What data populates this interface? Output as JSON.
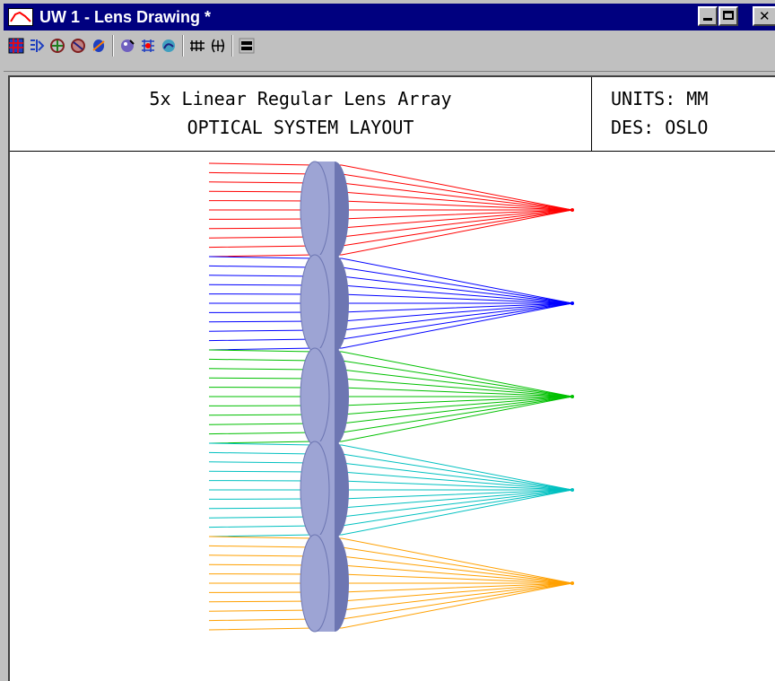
{
  "window": {
    "title": "UW 1 - Lens Drawing *"
  },
  "titlebar_icons": {
    "app": "graph-line-icon",
    "minimize": "minimize-icon",
    "maximize": "maximize-icon",
    "close": "close-icon"
  },
  "titlebar_glyphs": {
    "close": "✕"
  },
  "toolbar": {
    "buttons": [
      {
        "name": "grid-icon",
        "color": "#1f3fbf"
      },
      {
        "name": "lens-layout-icon",
        "color": "#1f3fbf"
      },
      {
        "name": "3d-ray-icon",
        "color": "#7f1f1f"
      },
      {
        "name": "solid-3d-icon",
        "color": "#7f1f1f"
      },
      {
        "name": "shaded-lens-icon",
        "color": "#1f3fbf"
      },
      {
        "name": "spot-diagram-icon",
        "color": "#3f1f7f"
      },
      {
        "name": "wavefront-icon",
        "color": "#1f3fbf"
      },
      {
        "name": "mtf-icon",
        "color": "#1f3fbf"
      },
      {
        "name": "field-curve-icon",
        "color": "#000000"
      },
      {
        "name": "aberration-icon",
        "color": "#000000"
      },
      {
        "name": "opc-icon",
        "color": "#000000"
      }
    ]
  },
  "drawing": {
    "title": "5x Linear Regular Lens Array",
    "subtitle": "OPTICAL SYSTEM LAYOUT",
    "units": "UNITS: MM",
    "designer": "DES: OSLO"
  },
  "colors": {
    "titlebar": "#00007f",
    "lens_fill": "#9da4d4",
    "lens_edge": "#6d76b2",
    "ray_red": "#ff0000",
    "ray_blue": "#0000ff",
    "ray_green": "#00c000",
    "ray_cyan": "#00c0c0",
    "ray_orange": "#ffa000"
  },
  "lens_array": {
    "count": 5,
    "rays_per_lens": 11,
    "ray_colors": [
      "#ff0000",
      "#0000ff",
      "#00c000",
      "#00c0c0",
      "#ffa000"
    ]
  }
}
